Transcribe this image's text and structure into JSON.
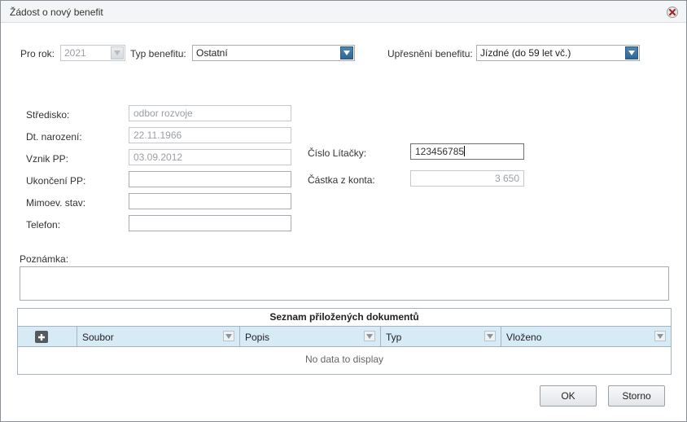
{
  "window": {
    "title": "Žádost o nový benefit"
  },
  "top": {
    "year_label": "Pro rok:",
    "year_value": "2021",
    "type_label": "Typ benefitu:",
    "type_value": "Ostatní",
    "spec_label": "Upřesnění benefitu:",
    "spec_value": "Jízdné (do 59 let vč.)"
  },
  "fields": {
    "stredisko_label": "Středisko:",
    "stredisko_value": "odbor rozvoje",
    "narozeni_label": "Dt. narození:",
    "narozeni_value": "22.11.1966",
    "vznik_label": "Vznik PP:",
    "vznik_value": "03.09.2012",
    "ukonceni_label": "Ukončení PP:",
    "ukonceni_value": "",
    "mimoev_label": "Mimoev. stav:",
    "mimoev_value": "",
    "telefon_label": "Telefon:",
    "telefon_value": "",
    "litacka_label": "Číslo Lítačky:",
    "litacka_value": "123456785",
    "castka_label": "Částka z konta:",
    "castka_value": "3 650"
  },
  "note": {
    "label": "Poznámka:",
    "value": ""
  },
  "documents": {
    "caption": "Seznam přiložených dokumentů",
    "columns": [
      "Soubor",
      "Popis",
      "Typ",
      "Vloženo"
    ],
    "empty_text": "No data to display"
  },
  "buttons": {
    "ok": "OK",
    "cancel": "Storno"
  },
  "colors": {
    "accent": "#2f6593",
    "grid_header": "#d6ebf5"
  }
}
